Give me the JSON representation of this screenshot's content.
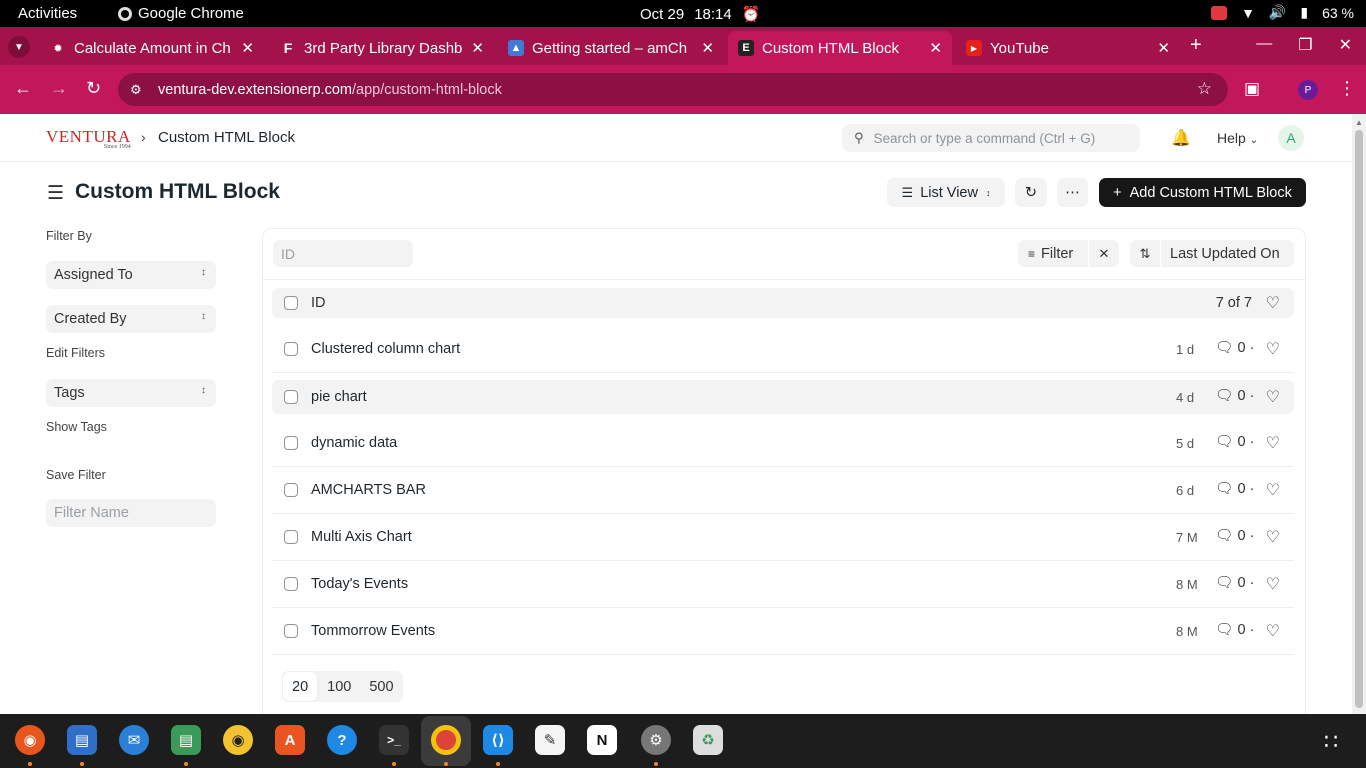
{
  "system": {
    "activities": "Activities",
    "app_name": "Google Chrome",
    "date": "Oct 29",
    "time": "18:14",
    "battery": "63 %"
  },
  "browser": {
    "tabs": [
      {
        "title": "Calculate Amount in Ch",
        "icon": "frappe-icon",
        "active": false
      },
      {
        "title": "3rd Party Library Dashb",
        "icon": "frappe-f-icon",
        "active": false
      },
      {
        "title": "Getting started – amCh",
        "icon": "amcharts-icon",
        "active": false
      },
      {
        "title": "Custom HTML Block",
        "icon": "erp-e-icon",
        "active": true
      },
      {
        "title": "YouTube",
        "icon": "youtube-icon",
        "active": false
      }
    ],
    "url_host": "ventura-dev.extensionerp.com",
    "url_path": "/app/custom-html-block",
    "profile_initial": "P"
  },
  "app_header": {
    "logo_text": "VENTURA",
    "logo_since": "Since 1994",
    "breadcrumb": "Custom HTML Block",
    "search_placeholder": "Search or type a command (Ctrl + G)",
    "help_label": "Help",
    "avatar_initial": "A"
  },
  "page": {
    "title": "Custom HTML Block",
    "view_label": "List View",
    "add_button": "Add Custom HTML Block"
  },
  "sidebar": {
    "filter_by": "Filter By",
    "assigned_to": "Assigned To",
    "created_by": "Created By",
    "edit_filters": "Edit Filters",
    "tags": "Tags",
    "show_tags": "Show Tags",
    "save_filter": "Save Filter",
    "filter_name_placeholder": "Filter Name"
  },
  "list": {
    "id_placeholder": "ID",
    "filter_label": "Filter",
    "sort_label": "Last Updated On",
    "column_id": "ID",
    "count": "7 of 7",
    "rows": [
      {
        "name": "Clustered column chart",
        "age": "1 d",
        "comments": "0"
      },
      {
        "name": "pie chart",
        "age": "4 d",
        "comments": "0"
      },
      {
        "name": "dynamic data",
        "age": "5 d",
        "comments": "0"
      },
      {
        "name": "AMCHARTS BAR",
        "age": "6 d",
        "comments": "0"
      },
      {
        "name": "Multi Axis Chart",
        "age": "7 M",
        "comments": "0"
      },
      {
        "name": "Today's Events",
        "age": "8 M",
        "comments": "0"
      },
      {
        "name": "Tommorrow Events",
        "age": "8 M",
        "comments": "0"
      }
    ],
    "page_sizes": [
      "20",
      "100",
      "500"
    ]
  },
  "dock": {
    "apps": [
      "firefox-icon",
      "writer-icon",
      "thunderbird-icon",
      "files-icon",
      "rhythmbox-icon",
      "app-center-icon",
      "help-icon",
      "terminal-icon",
      "chrome-icon",
      "vscode-icon",
      "text-editor-icon",
      "notion-icon",
      "settings-icon",
      "trash-icon"
    ]
  }
}
